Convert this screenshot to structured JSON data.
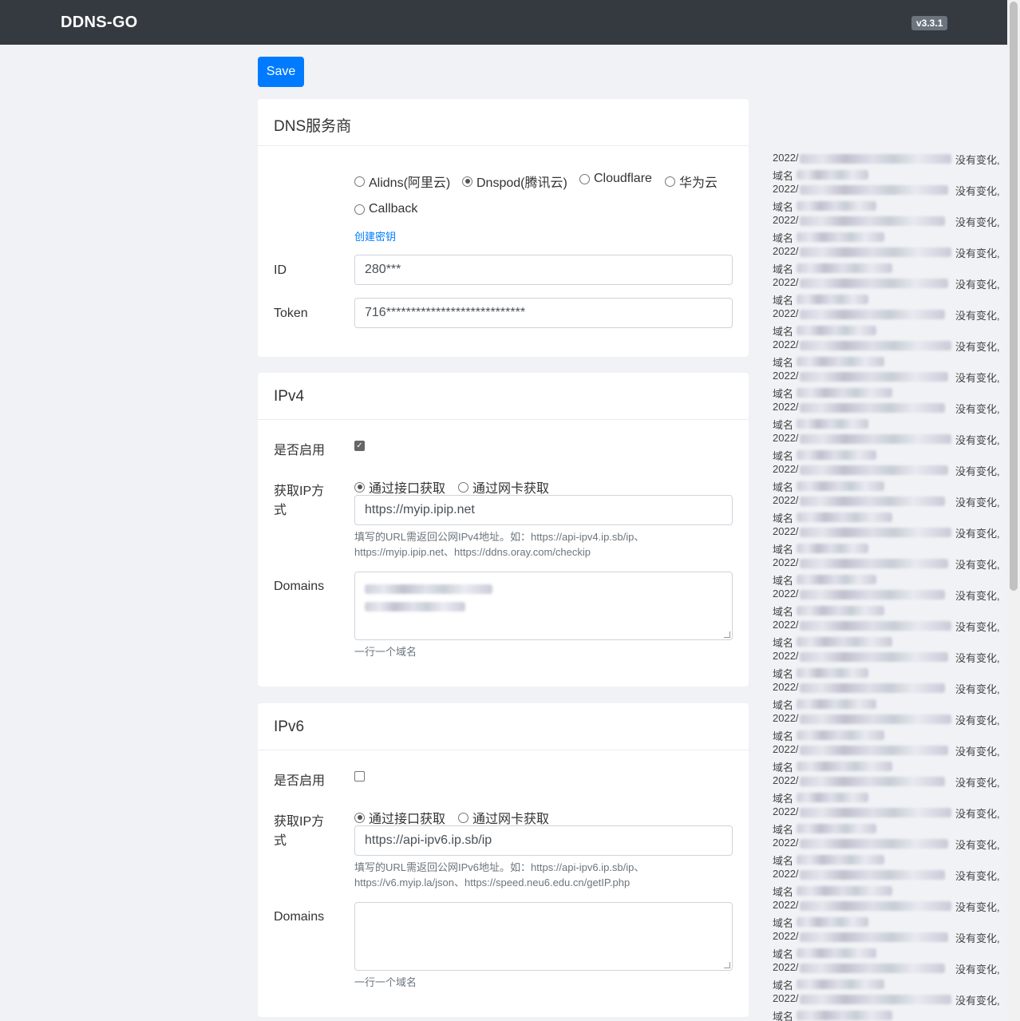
{
  "navbar": {
    "brand": "DDNS-GO",
    "version": "v3.3.1"
  },
  "toolbar": {
    "save_label": "Save"
  },
  "dns_card": {
    "title": "DNS服务商",
    "providers": [
      {
        "label": "Alidns(阿里云)",
        "checked": false
      },
      {
        "label": "Dnspod(腾讯云)",
        "checked": true
      },
      {
        "label": "Cloudflare",
        "checked": false
      },
      {
        "label": "华为云",
        "checked": false
      },
      {
        "label": "Callback",
        "checked": false
      }
    ],
    "create_key_link": "创建密钥",
    "id_label": "ID",
    "id_value": "280***",
    "token_label": "Token",
    "token_value": "716****************************"
  },
  "ipv4_card": {
    "title": "IPv4",
    "enable_label": "是否启用",
    "enabled": true,
    "method_label": "获取IP方式",
    "method_options": [
      {
        "label": "通过接口获取",
        "checked": true
      },
      {
        "label": "通过网卡获取",
        "checked": false
      }
    ],
    "url_value": "https://myip.ipip.net",
    "url_help_line1": "填写的URL需返回公网IPv4地址。如：https://api-ipv4.ip.sb/ip、",
    "url_help_line2": "https://myip.ipip.net、https://ddns.oray.com/checkip",
    "domains_label": "Domains",
    "domains_help": "一行一个域名"
  },
  "ipv6_card": {
    "title": "IPv6",
    "enable_label": "是否启用",
    "enabled": false,
    "method_label": "获取IP方式",
    "method_options": [
      {
        "label": "通过接口获取",
        "checked": true
      },
      {
        "label": "通过网卡获取",
        "checked": false
      }
    ],
    "url_value": "https://api-ipv6.ip.sb/ip",
    "url_help_line1": "填写的URL需返回公网IPv6地址。如：https://api-ipv6.ip.sb/ip、",
    "url_help_line2": "https://v6.myip.la/json、https://speed.neu6.edu.cn/getIP.php",
    "domains_label": "Domains",
    "domains_help": "一行一个域名"
  },
  "log": {
    "date_prefix": "2022/",
    "domain_prefix": "域名",
    "no_change": "没有变化,",
    "entry_count": 28
  }
}
